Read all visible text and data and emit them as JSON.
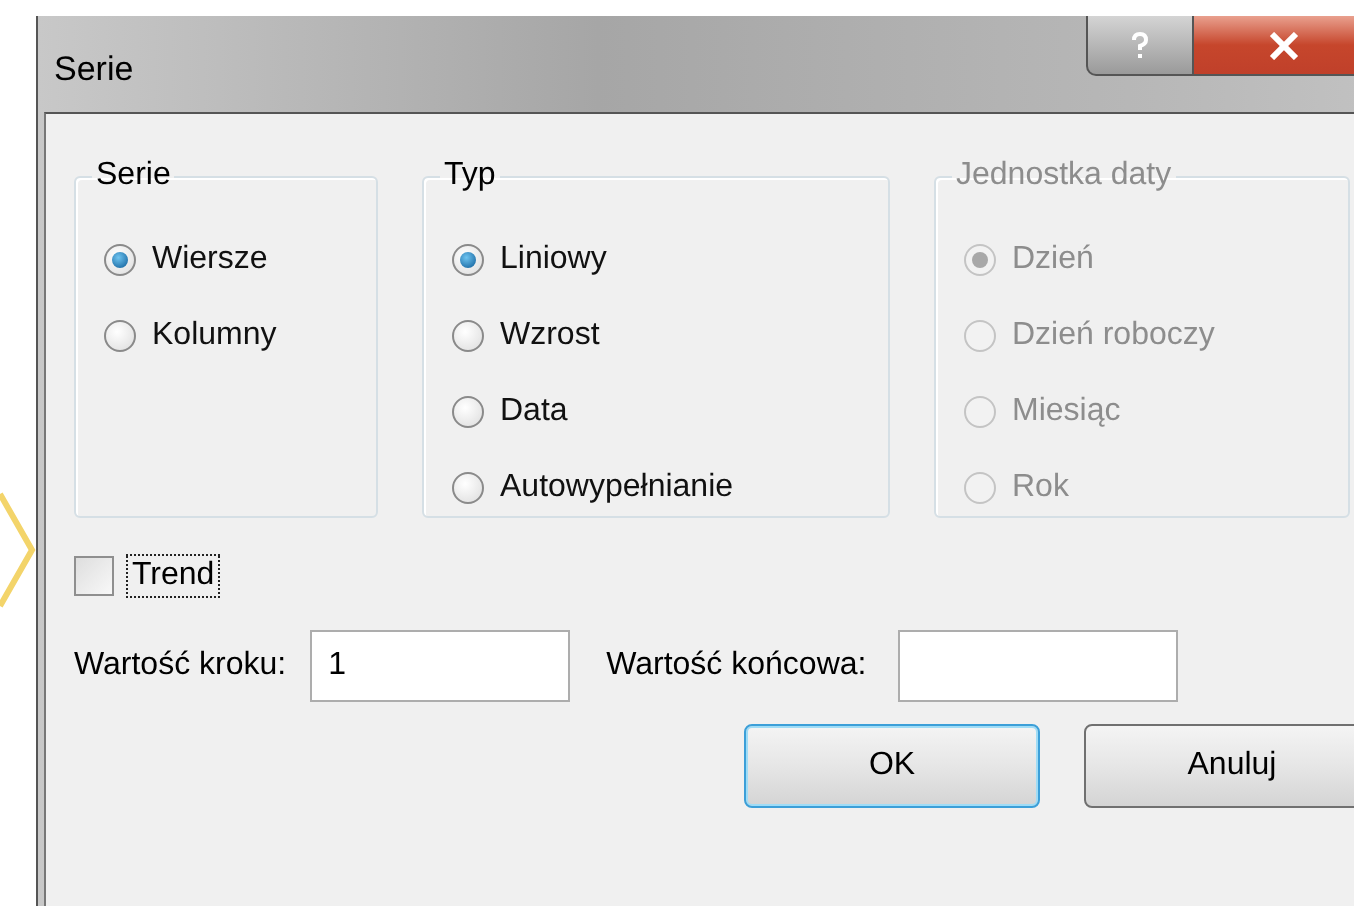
{
  "window": {
    "title": "Serie"
  },
  "groups": [
    {
      "title": "Serie",
      "disabled": false,
      "options": [
        {
          "label": "Wiersze",
          "selected": true
        },
        {
          "label": "Kolumny",
          "selected": false
        }
      ]
    },
    {
      "title": "Typ",
      "disabled": false,
      "options": [
        {
          "label": "Liniowy",
          "selected": true
        },
        {
          "label": "Wzrost",
          "selected": false
        },
        {
          "label": "Data",
          "selected": false
        },
        {
          "label": "Autowypełnianie",
          "selected": false
        }
      ]
    },
    {
      "title": "Jednostka daty",
      "disabled": true,
      "options": [
        {
          "label": "Dzień",
          "selected": true
        },
        {
          "label": "Dzień roboczy",
          "selected": false
        },
        {
          "label": "Miesiąc",
          "selected": false
        },
        {
          "label": "Rok",
          "selected": false
        }
      ]
    }
  ],
  "trend": {
    "label": "Trend",
    "checked": false,
    "focused": true
  },
  "step": {
    "label": "Wartość kroku:",
    "value": "1"
  },
  "stop": {
    "label": "Wartość końcowa:"
  },
  "buttons": [
    {
      "label": "OK",
      "default": true
    },
    {
      "label": "Anuluj",
      "default": false
    }
  ]
}
